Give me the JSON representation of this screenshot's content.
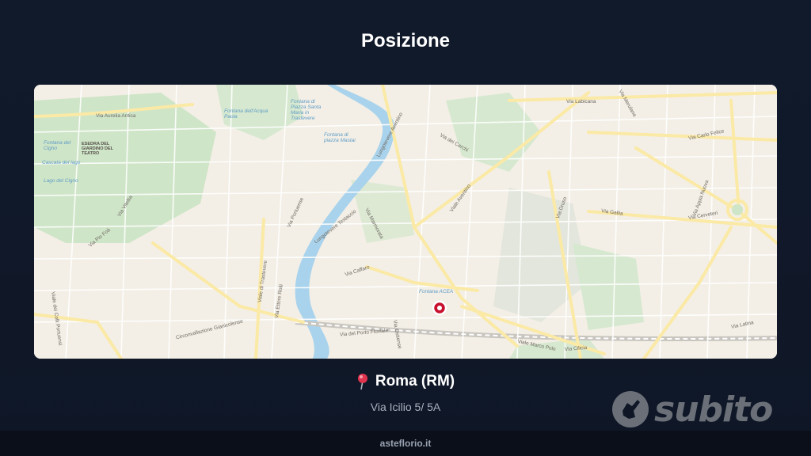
{
  "header": {
    "title": "Posizione"
  },
  "map": {
    "labels": {
      "via_aurelia_antica": "Via Aurelia Antica",
      "fontana_acqua_paola": "Fontana dell'Acqua Paola",
      "fontana_piazza": "Fontana di Piazza Santa Maria in Trastevere",
      "fontana_mastai": "Fontana di piazza Mastai",
      "parco_cigno": "Fontana del Cigno",
      "esedra": "ESEDRA DEL GIARDINO DEL TEATRO",
      "lago": "Lago del Cigno",
      "cascata": "Cascata del lago",
      "lungotevere_aventino": "Lungotevere Aventino",
      "via_dei_cerchi": "Via dei Cerchi",
      "via_labicana": "Via Labicana",
      "via_merulana": "Via Merulana",
      "via_carlo_felice": "Via Carlo Felice",
      "via_aventino": "Viale Aventino",
      "via_marmorata": "Via Marmorata",
      "via_portuense": "Via Portuense",
      "lungotevere_testaccio": "Lungotevere Testaccio",
      "via_vitellia": "Via Vitellia",
      "via_pio_foa": "Via Pio Foà",
      "via_gallia": "Via Gallia",
      "via_appia_nuova": "Via Appia Nuova",
      "via_cerveteri": "Via Cerveteri",
      "via_trastevere": "Viale di Trastevere",
      "via_ettore_rolli": "Via Ettore Rolli",
      "circonvallazione": "Circonvallazione Gianicolense",
      "via_porto_fluviale": "Via del Porto Fluviale",
      "via_ostiense": "Via Ostiense",
      "viale_marco_polo": "Viale Marco Polo",
      "via_cilicia": "Via Cilicia",
      "fontana_acea": "Fontana ACEA",
      "via_caffaro": "Via Caffaro",
      "via_dei_colli_portuensi": "Viale dei Colli Portuensi",
      "via_druso": "Via Druso",
      "via_latina": "Via Latina"
    }
  },
  "location": {
    "city": "Roma (RM)",
    "address": "Via Icilio 5/ 5A",
    "pin_icon": "red-pushpin-icon"
  },
  "brand": {
    "name": "subito"
  },
  "footer": {
    "site": "asteflorio.it"
  },
  "colors": {
    "background": "#111a2b",
    "map_land": "#f3efe6",
    "map_park": "#cfe5c8",
    "map_water": "#a9d3ec",
    "road_major": "#fbe9a6",
    "pin_red": "#c8102e",
    "brand_grey": "#6b7078"
  }
}
